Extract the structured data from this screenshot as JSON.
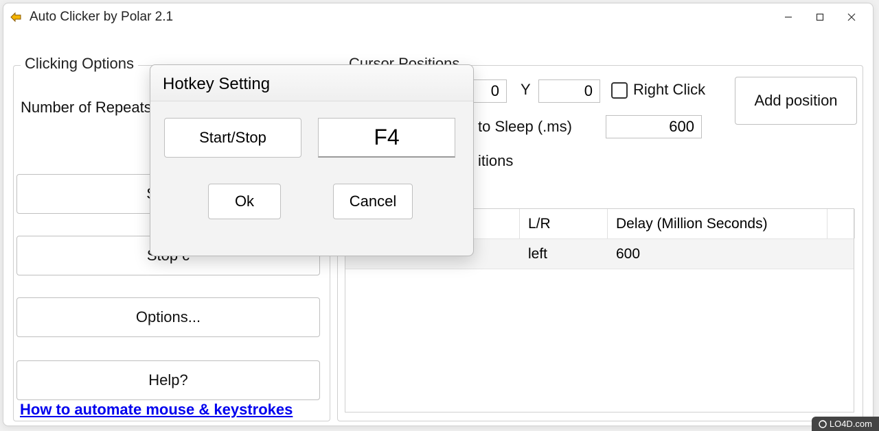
{
  "window": {
    "title": "Auto Clicker by Polar 2.1"
  },
  "clicking_options": {
    "group_label": "Clicking Options",
    "repeats_label": "Number of Repeats",
    "start_button": "Start c",
    "stop_button": "Stop c",
    "options_button": "Options...",
    "help_button": "Help?",
    "link_text": "How to automate mouse & keystrokes"
  },
  "cursor_positions": {
    "group_label": "Cursor Positions",
    "x_value": "0",
    "y_label": "Y",
    "y_value": "0",
    "right_click_label": "Right Click",
    "sleep_label_partial": "to Sleep (.ms)",
    "sleep_value": "600",
    "add_position_button": "Add position",
    "itions_label_partial": "itions",
    "table": {
      "headers": [
        "",
        "L/R",
        "Delay (Million Seconds)"
      ],
      "rows": [
        {
          "col0": "",
          "lr": "left",
          "delay": "600"
        }
      ]
    }
  },
  "dialog": {
    "title": "Hotkey Setting",
    "startstop_button": "Start/Stop",
    "hotkey_value": "F4",
    "ok_button": "Ok",
    "cancel_button": "Cancel"
  },
  "badge": "LO4D.com"
}
